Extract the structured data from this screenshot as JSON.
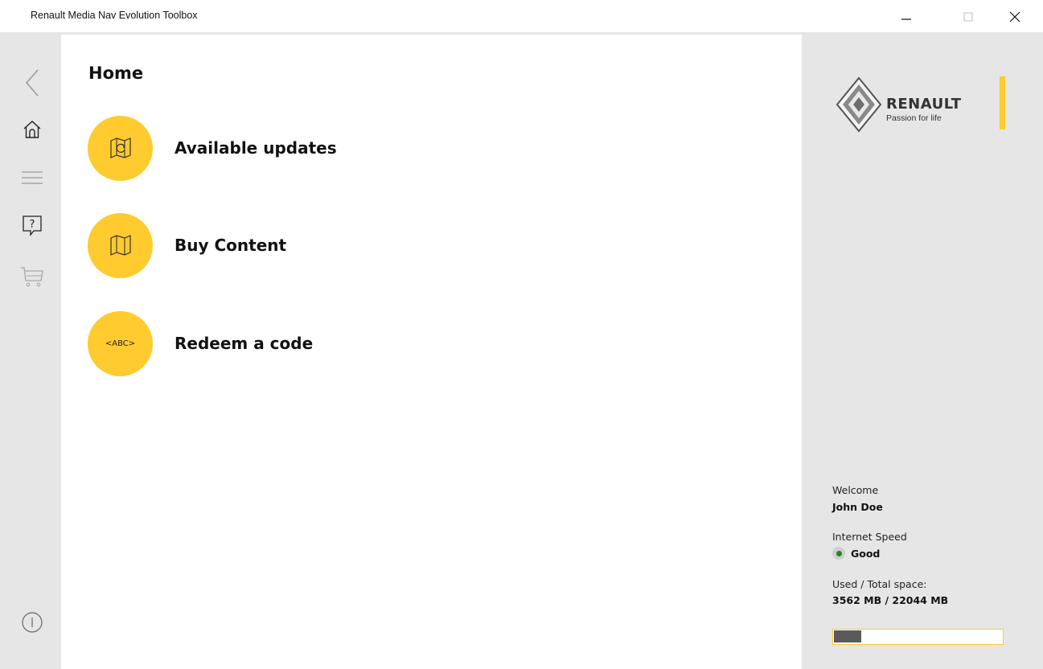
{
  "window": {
    "title": "Renault Media Nav Evolution Toolbox",
    "controls": [
      "minimize-icon",
      "maximize-icon",
      "close-icon"
    ]
  },
  "sidebar": {
    "icons": [
      "back-chevron-icon",
      "home-icon",
      "menu-icon",
      "help-icon",
      "cart-icon"
    ],
    "bottom_icon": "power-icon"
  },
  "main": {
    "title": "Home",
    "items": [
      {
        "label": "Available updates",
        "icon": "map-update-icon"
      },
      {
        "label": "Buy Content",
        "icon": "map-icon"
      },
      {
        "label": "Redeem a code",
        "icon": "abc-code-icon",
        "icon_text": "<ABC>"
      }
    ]
  },
  "brand": {
    "name": "RENAULT",
    "tagline": "Passion for life",
    "logo_icon": "renault-diamond-logo"
  },
  "account": {
    "welcome_label": "Welcome",
    "user_name": "John Doe",
    "speed_label": "Internet Speed",
    "speed_value": "Good",
    "space_label": "Used / Total space:",
    "space_value": "3562 MB / 22044 MB",
    "space_used_fraction": 0.1616
  },
  "colors": {
    "accent": "#ffcb2f",
    "sidebar_bg": "#e6e6e6",
    "status_good": "#1f8a1f",
    "progress_fill": "#5a5a5a"
  }
}
